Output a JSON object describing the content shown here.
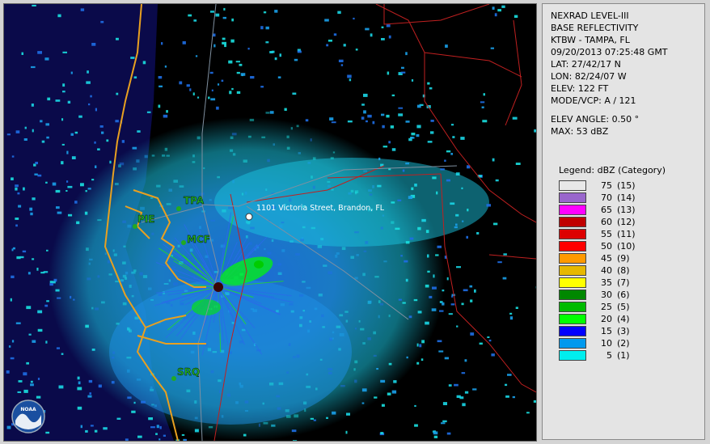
{
  "header": {
    "lines": [
      "NEXRAD LEVEL-III",
      "BASE REFLECTIVITY",
      "KTBW - TAMPA, FL",
      "09/20/2013 07:25:48 GMT",
      "LAT: 27/42/17 N",
      "LON: 82/24/07 W",
      "ELEV: 122 FT",
      "MODE/VCP: A / 121"
    ],
    "elev_angle": "ELEV ANGLE: 0.50 °",
    "max": "MAX: 53 dBZ"
  },
  "legend": {
    "title": "Legend: dBZ (Category)",
    "items": [
      {
        "value": "75",
        "category": "(15)",
        "color": "#e8e8e8"
      },
      {
        "value": "70",
        "category": "(14)",
        "color": "#9966cc"
      },
      {
        "value": "65",
        "category": "(13)",
        "color": "#ff00ff"
      },
      {
        "value": "60",
        "category": "(12)",
        "color": "#c00000"
      },
      {
        "value": "55",
        "category": "(11)",
        "color": "#dd0000"
      },
      {
        "value": "50",
        "category": "(10)",
        "color": "#ff0000"
      },
      {
        "value": "45",
        "category": "(9)",
        "color": "#ff9900"
      },
      {
        "value": "40",
        "category": "(8)",
        "color": "#e6b800"
      },
      {
        "value": "35",
        "category": "(7)",
        "color": "#ffff00"
      },
      {
        "value": "30",
        "category": "(6)",
        "color": "#008800"
      },
      {
        "value": "25",
        "category": "(5)",
        "color": "#00bb00"
      },
      {
        "value": "20",
        "category": "(4)",
        "color": "#00ff00"
      },
      {
        "value": "15",
        "category": "(3)",
        "color": "#0000ff"
      },
      {
        "value": "10",
        "category": "(2)",
        "color": "#0099ee"
      },
      {
        "value": "5",
        "category": "(1)",
        "color": "#00eeee"
      }
    ]
  },
  "map": {
    "marker_label": "1101 Victoria Street, Brandon, FL",
    "stations": [
      "TPA",
      "PIE",
      "MCF",
      "SRQ"
    ],
    "logo": "NOAA"
  }
}
